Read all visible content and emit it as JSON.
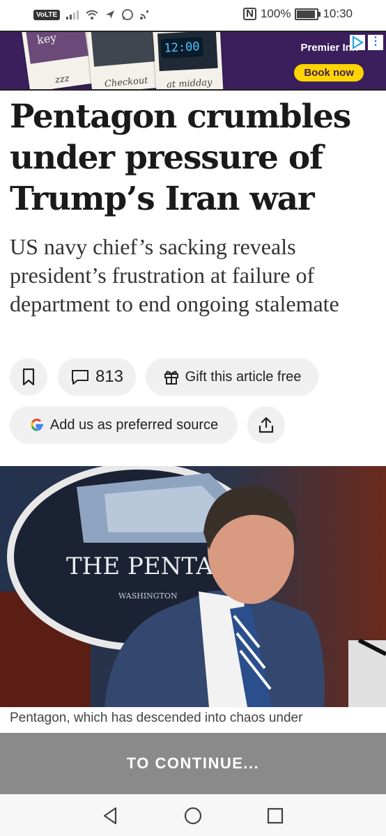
{
  "status_bar": {
    "volte": "VoLTE",
    "battery": "100%",
    "time": "10:30",
    "battery_level": 1.0
  },
  "ad": {
    "caption_1": "zzz",
    "caption_2": "Checkout",
    "caption_3": "at midday",
    "clock": "12:00",
    "key_text": "key",
    "brand": "Premier Inn",
    "cta": "Book now"
  },
  "article": {
    "headline": "Pentagon crumbles under pressure of Trump’s Iran war",
    "standfirst": "US navy chief’s sacking reveals president’s frustration at failure of department to end ongoing stalemate",
    "comment_count": "813",
    "gift_label": "Gift this article free",
    "preferred_source_label": "Add us as preferred source",
    "photo_sign_text": "THE PENTAGON",
    "photo_sign_subtext": "WASHINGTON",
    "caption": "Pentagon, which has descended into chaos under"
  },
  "paywall": {
    "label": "TO CONTINUE..."
  },
  "icons": [
    "bookmark-icon",
    "comment-icon",
    "gift-icon",
    "google-icon",
    "share-icon",
    "back-icon",
    "home-icon",
    "recents-icon"
  ]
}
